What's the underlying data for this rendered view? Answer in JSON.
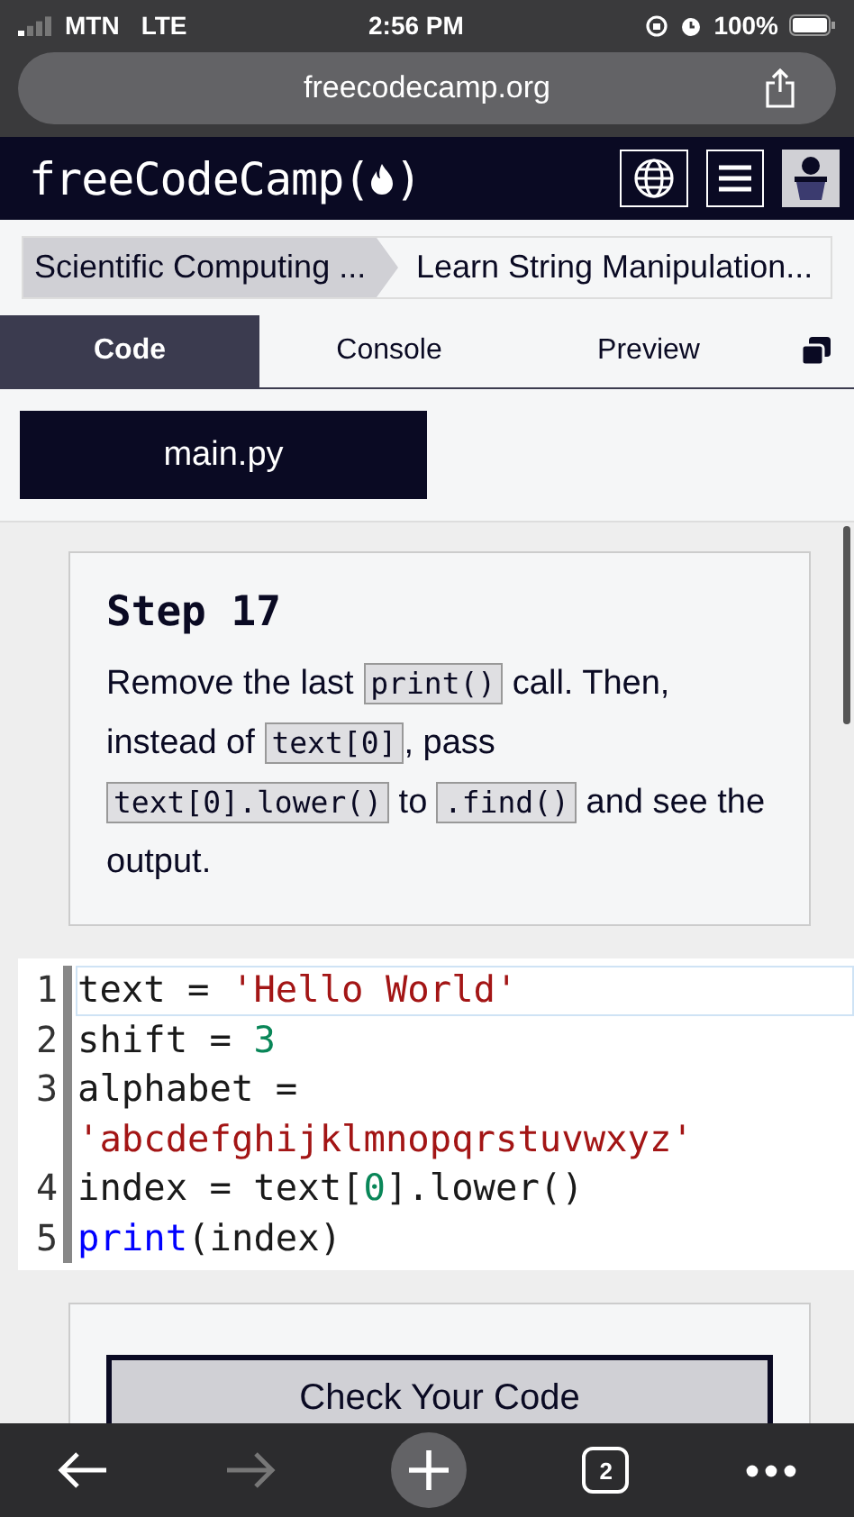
{
  "status_bar": {
    "carrier": "MTN",
    "network": "LTE",
    "time": "2:56 PM",
    "battery": "100%"
  },
  "browser": {
    "url": "freecodecamp.org",
    "tab_count": "2"
  },
  "navbar": {
    "logo_prefix": "freeCodeCamp(",
    "logo_suffix": ")"
  },
  "breadcrumbs": [
    {
      "label": "Scientific Computing ..."
    },
    {
      "label": "Learn String Manipulation..."
    }
  ],
  "tabs": [
    {
      "label": "Code",
      "selected": true
    },
    {
      "label": "Console",
      "selected": false
    },
    {
      "label": "Preview",
      "selected": false
    }
  ],
  "file_tab": "main.py",
  "step": {
    "title": "Step 17",
    "segments": [
      {
        "kind": "text",
        "text": "Remove the last"
      },
      {
        "kind": "code",
        "text": "print()"
      },
      {
        "kind": "text",
        "text": "call. Then, instead of"
      },
      {
        "kind": "code",
        "text": "text[0]"
      },
      {
        "kind": "text",
        "text": ", pass"
      },
      {
        "kind": "code",
        "text": "text[0].lower()"
      },
      {
        "kind": "text",
        "text": "to"
      },
      {
        "kind": "code",
        "text": ".find()"
      },
      {
        "kind": "text",
        "text": "and see the output."
      }
    ]
  },
  "editor": {
    "lines": [
      {
        "number": "1",
        "active": true,
        "tokens": [
          {
            "kind": "plain",
            "text": "text = "
          },
          {
            "kind": "string",
            "text": "'Hello World'"
          }
        ]
      },
      {
        "number": "2",
        "active": false,
        "tokens": [
          {
            "kind": "plain",
            "text": "shift = "
          },
          {
            "kind": "number",
            "text": "3"
          }
        ]
      },
      {
        "number": "3",
        "active": false,
        "tokens": [
          {
            "kind": "plain",
            "text": "alphabet ="
          }
        ]
      },
      {
        "active": false,
        "tokens": [
          {
            "kind": "string",
            "text": "'abcdefghijklmnopqrstuvwxyz'"
          }
        ]
      },
      {
        "number": "4",
        "active": false,
        "tokens": [
          {
            "kind": "plain",
            "text": "index = text["
          },
          {
            "kind": "number",
            "text": "0"
          },
          {
            "kind": "plain",
            "text": "].lower()"
          }
        ]
      },
      {
        "number": "5",
        "active": false,
        "tokens": [
          {
            "kind": "keyword",
            "text": "print"
          },
          {
            "kind": "plain",
            "text": "(index)"
          }
        ]
      }
    ]
  },
  "check_button": "Check Your Code"
}
